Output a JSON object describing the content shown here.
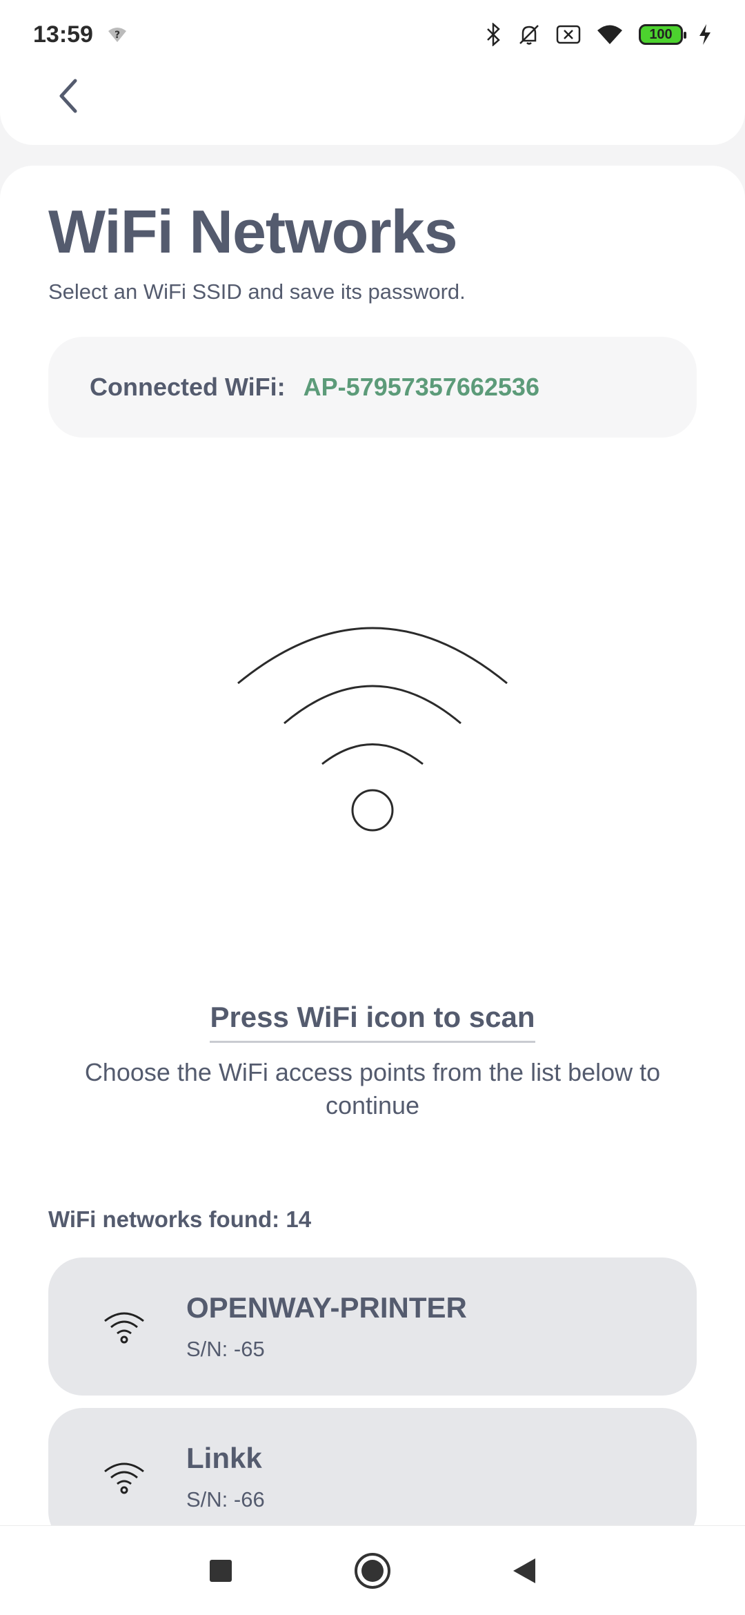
{
  "status_bar": {
    "time": "13:59",
    "battery_level": "100",
    "icons": [
      "wifi-question-icon",
      "bluetooth-icon",
      "bell-off-icon",
      "sim-x-icon",
      "wifi-icon",
      "battery-icon",
      "charging-icon"
    ]
  },
  "header": {
    "back_icon": "chevron-left-icon"
  },
  "page": {
    "title": "WiFi Networks",
    "subtitle": "Select an WiFi SSID and save its password."
  },
  "connected": {
    "label": "Connected WiFi:",
    "ssid": "AP-57957357662536",
    "value_color": "#5c9b79"
  },
  "scan": {
    "link_label": "Press WiFi icon to scan",
    "hint": "Choose the WiFi access points from the list below to continue"
  },
  "networks": {
    "count_label": "WiFi networks found: 14",
    "items": [
      {
        "name": "OPENWAY-PRINTER",
        "signal": "S/N: -65"
      },
      {
        "name": "Linkk",
        "signal": "S/N: -66"
      }
    ]
  },
  "nav": {
    "icons": [
      "recents-square-icon",
      "home-circle-icon",
      "back-triangle-icon"
    ]
  }
}
